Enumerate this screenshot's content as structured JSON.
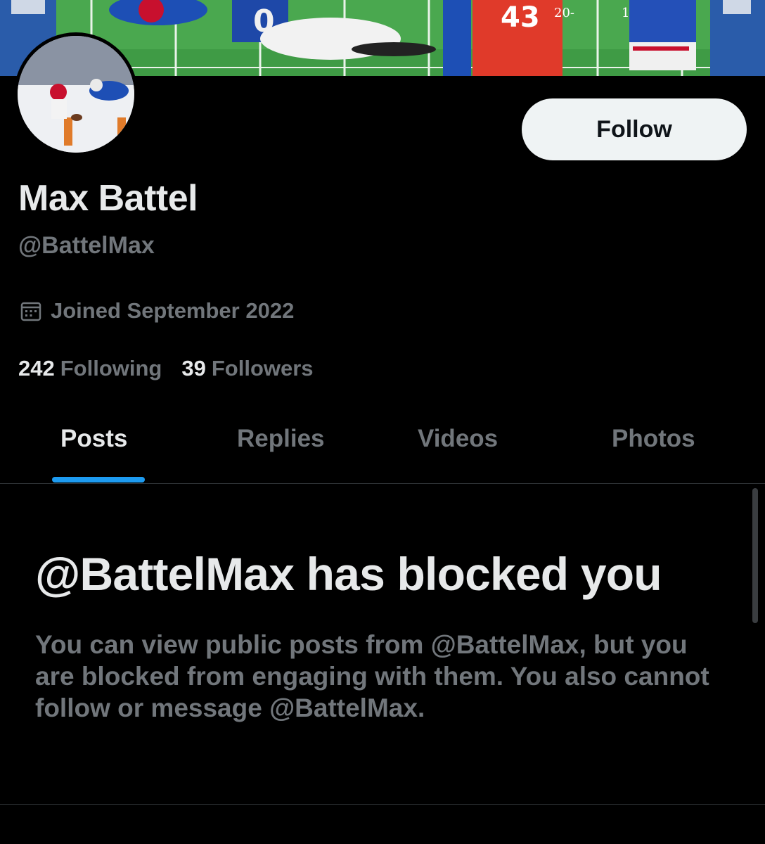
{
  "profile": {
    "display_name": "Max Battel",
    "handle": "@BattelMax",
    "joined": "Joined September 2022",
    "following_count": "242",
    "following_label": "Following",
    "followers_count": "39",
    "followers_label": "Followers"
  },
  "actions": {
    "follow_label": "Follow"
  },
  "tabs": [
    {
      "label": "Posts",
      "active": true
    },
    {
      "label": "Replies",
      "active": false
    },
    {
      "label": "Videos",
      "active": false
    },
    {
      "label": "Photos",
      "active": false
    }
  ],
  "blocked": {
    "title": "@BattelMax has blocked you",
    "body": "You can view public posts from @BattelMax, but you are blocked from engaging with them. You also cannot follow or message @BattelMax."
  },
  "icons": {
    "joined": "calendar-icon"
  },
  "colors": {
    "background": "#000000",
    "primary_text": "#e7e9ea",
    "secondary_text": "#71767b",
    "accent": "#1d9bf0",
    "follow_bg": "#eff3f4"
  }
}
